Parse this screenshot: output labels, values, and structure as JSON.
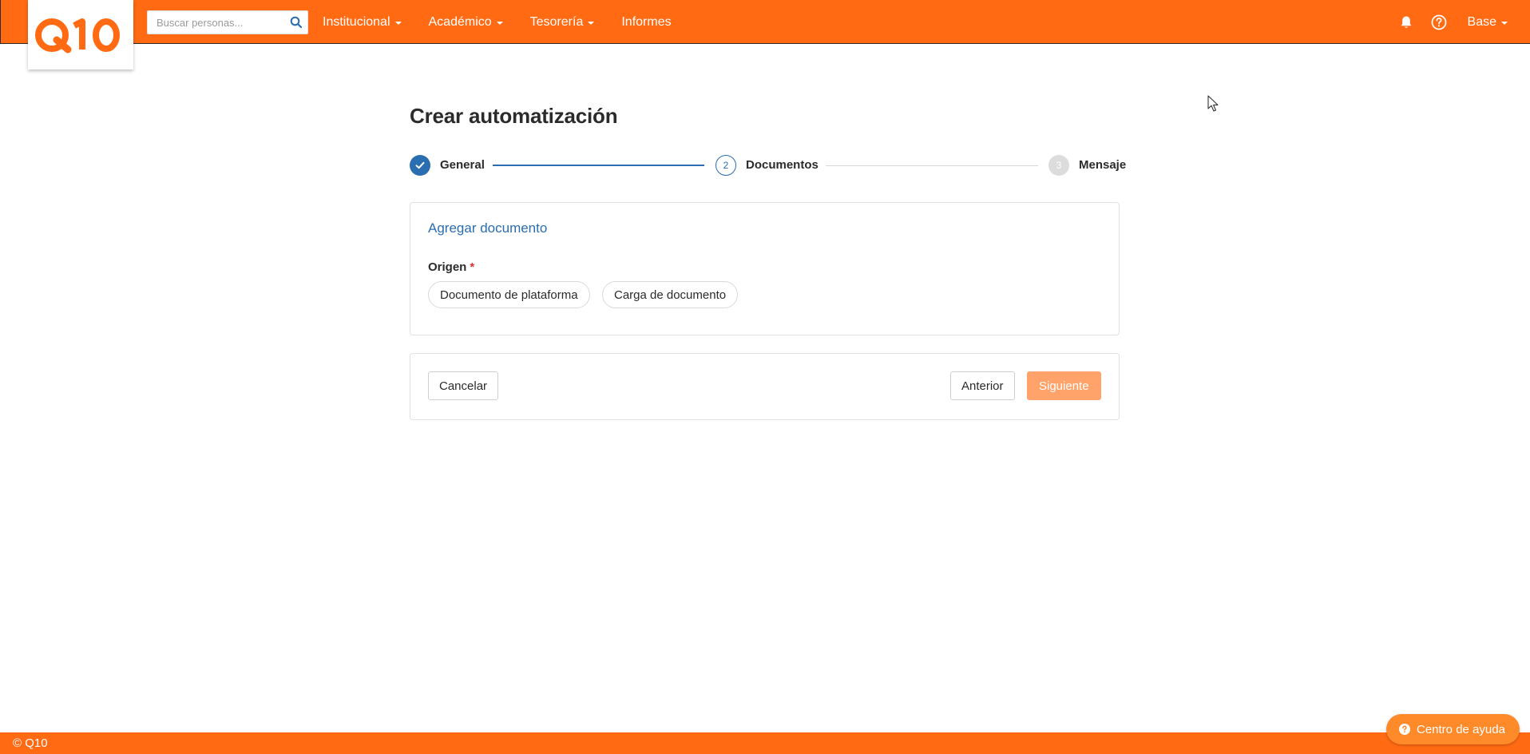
{
  "header": {
    "logo_text": "Q10",
    "search_placeholder": "Buscar personas...",
    "nav": [
      {
        "label": "Institucional",
        "has_caret": true
      },
      {
        "label": "Académico",
        "has_caret": true
      },
      {
        "label": "Tesorería",
        "has_caret": true
      },
      {
        "label": "Informes",
        "has_caret": false
      }
    ],
    "user_label": "Base",
    "icons": {
      "search": "search-icon",
      "notifications": "bell-icon",
      "help": "question-circle-icon"
    }
  },
  "page": {
    "title": "Crear automatización"
  },
  "stepper": {
    "steps": [
      {
        "label": "General",
        "state": "completed",
        "marker": ""
      },
      {
        "label": "Documentos",
        "state": "active",
        "marker": "2"
      },
      {
        "label": "Mensaje",
        "state": "pending",
        "marker": "3"
      }
    ]
  },
  "document_card": {
    "title": "Agregar documento",
    "origin_label": "Origen",
    "required_mark": "*",
    "options": [
      "Documento de plataforma",
      "Carga de documento"
    ]
  },
  "actions": {
    "cancel": "Cancelar",
    "previous": "Anterior",
    "next": "Siguiente"
  },
  "footer": {
    "copyright": "© Q10",
    "help_center": "Centro de ayuda"
  },
  "colors": {
    "brand_orange": "#ff6a13",
    "primary_blue": "#2a6db0",
    "next_button_disabled": "#ffa36a",
    "help_center": "#ff8a2a",
    "required_red": "#d9343a"
  }
}
